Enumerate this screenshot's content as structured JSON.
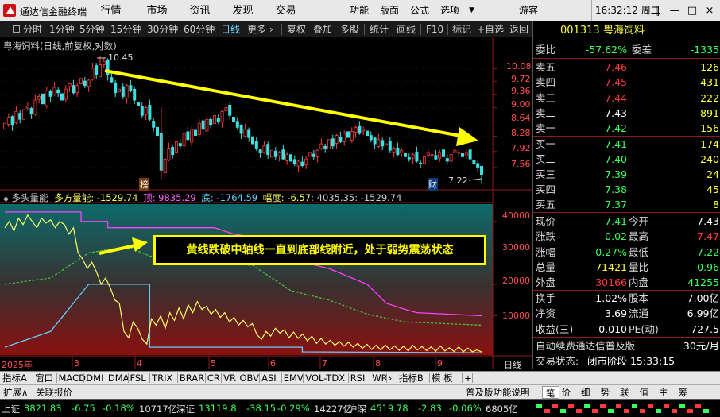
{
  "app": {
    "title": "通达信金融终端",
    "menus": [
      "行情",
      "市场",
      "资讯",
      "发现",
      "交易"
    ],
    "right_menus": [
      "功能",
      "版面",
      "公式",
      "选项"
    ],
    "user": "游客",
    "clock": "16:32:12 周二",
    "win_buttons": [
      "ǁ",
      "—",
      "□",
      "×"
    ]
  },
  "toolbar": {
    "periods": [
      "分时",
      "1分钟",
      "5分钟",
      "15分钟",
      "30分钟",
      "60分钟",
      "日线",
      "更多"
    ],
    "more_arrow": "›",
    "tools": [
      "复权",
      "叠加",
      "多股",
      "统计",
      "画线",
      "F10",
      "标记",
      "+自选",
      "返回"
    ]
  },
  "chart": {
    "main_title": "粤海饲料(日线,前复权,对数)",
    "price_ticks": [
      "10.08",
      "9.72",
      "9.36",
      "9.00",
      "8.64",
      "8.28",
      "7.92",
      "7.56"
    ],
    "high_label": "10.45",
    "low_label": "7.22",
    "badge_left": "榜",
    "badge_right": "财",
    "indicator": {
      "name": "多头量能",
      "label_main": "多方量能",
      "value_main": "-1529.74",
      "label_top": "顶",
      "value_top": "9835.29",
      "label_bottom": "底",
      "value_bottom": "-1764.59",
      "label_amp": "幅度",
      "value_amp": "-6.57",
      "value_amp2": "4035.35",
      "value_last": "-1529.74"
    },
    "ind_ticks": [
      "40000",
      "30000",
      "20000",
      "10000"
    ],
    "annotation": "黄线跌破中轴线一直到底部线附近，处于弱势震荡状态",
    "time_labels": [
      "2025年",
      "3",
      "4",
      "5",
      "6",
      "7",
      "8",
      "9"
    ],
    "period_label": "日线"
  },
  "chart_data": {
    "type": "candlestick",
    "title": "粤海饲料(日线,前复权,对数)",
    "y_scale": "log",
    "ylim": [
      7.2,
      10.5
    ],
    "y_ticks": [
      7.56,
      7.92,
      8.28,
      8.64,
      9.0,
      9.36,
      9.72,
      10.08
    ],
    "x_months": [
      "2025年",
      "3",
      "4",
      "5",
      "6",
      "7",
      "8",
      "9"
    ],
    "high": 10.45,
    "low": 7.22,
    "closes": [
      8.6,
      8.75,
      8.55,
      8.9,
      8.7,
      8.95,
      9.05,
      8.85,
      9.2,
      9.3,
      9.1,
      9.45,
      9.3,
      9.55,
      9.4,
      9.2,
      9.5,
      9.65,
      9.4,
      9.6,
      9.8,
      9.6,
      9.75,
      10.1,
      9.9,
      10.2,
      10.3,
      9.9,
      9.7,
      9.4,
      9.5,
      9.3,
      9.6,
      9.45,
      9.2,
      9.05,
      8.8,
      9.0,
      8.7,
      8.5,
      8.3,
      7.5,
      7.75,
      8.0,
      7.85,
      8.15,
      8.05,
      8.35,
      8.2,
      8.45,
      8.3,
      8.6,
      8.45,
      8.7,
      8.55,
      8.8,
      8.65,
      8.9,
      9.0,
      8.8,
      8.65,
      8.5,
      8.35,
      8.45,
      8.25,
      8.1,
      8.0,
      7.9,
      8.05,
      7.85,
      7.95,
      7.8,
      7.9,
      7.75,
      7.85,
      7.7,
      7.65,
      7.7,
      7.6,
      7.75,
      7.9,
      7.8,
      7.95,
      8.1,
      8.0,
      8.2,
      8.05,
      8.3,
      8.15,
      8.35,
      8.25,
      8.4,
      8.5,
      8.35,
      8.45,
      8.3,
      8.2,
      8.1,
      8.2,
      8.05,
      8.1,
      7.95,
      8.0,
      7.85,
      7.95,
      7.8,
      7.75,
      7.85,
      7.7,
      7.65,
      7.8,
      7.9,
      7.85,
      7.75,
      7.9,
      7.8,
      7.7,
      7.85,
      7.95,
      7.9,
      7.8,
      7.9,
      7.75,
      7.65,
      7.55,
      7.41
    ],
    "indicator": {
      "name": "多头量能",
      "ylim": [
        -2000,
        45000
      ],
      "y_ticks": [
        10000,
        20000,
        30000,
        40000
      ],
      "series": [
        {
          "label": "多方量能",
          "color": "#ffff66",
          "last": -1529.74
        },
        {
          "label": "顶",
          "color": "#ff40ff",
          "last": 9835.29
        },
        {
          "label": "底",
          "color": "#60d0ff",
          "last": -1764.59
        },
        {
          "label": "中轴",
          "color": "#40d040"
        }
      ]
    }
  },
  "quote": {
    "code": "001313",
    "name": "粤海饲料",
    "weibi_label": "委比",
    "weibi": "-57.62%",
    "weicha_label": "委差",
    "weicha": "-1335",
    "asks": [
      {
        "label": "卖五",
        "price": "7.46",
        "vol": "126"
      },
      {
        "label": "卖四",
        "price": "7.45",
        "vol": "431"
      },
      {
        "label": "卖三",
        "price": "7.44",
        "vol": "222"
      },
      {
        "label": "卖二",
        "price": "7.43",
        "vol": "891"
      },
      {
        "label": "卖一",
        "price": "7.42",
        "vol": "156"
      }
    ],
    "bids": [
      {
        "label": "买一",
        "price": "7.41",
        "vol": "174"
      },
      {
        "label": "买二",
        "price": "7.40",
        "vol": "240"
      },
      {
        "label": "买三",
        "price": "7.39",
        "vol": "24"
      },
      {
        "label": "买四",
        "price": "7.38",
        "vol": "45"
      },
      {
        "label": "买五",
        "price": "7.37",
        "vol": "8"
      }
    ],
    "stats": [
      {
        "l1": "现价",
        "v1": "7.41",
        "c1": "grn",
        "l2": "今开",
        "v2": "7.43",
        "c2": "wht"
      },
      {
        "l1": "涨跌",
        "v1": "-0.02",
        "c1": "grn",
        "l2": "最高",
        "v2": "7.47",
        "c2": "red"
      },
      {
        "l1": "涨幅",
        "v1": "-0.27%",
        "c1": "grn",
        "l2": "最低",
        "v2": "7.22",
        "c2": "grn"
      },
      {
        "l1": "总量",
        "v1": "71421",
        "c1": "yel",
        "l2": "量比",
        "v2": "0.96",
        "c2": "grn"
      },
      {
        "l1": "外盘",
        "v1": "30166",
        "c1": "red",
        "l2": "内盘",
        "v2": "41255",
        "c2": "grn"
      }
    ],
    "stats2": [
      {
        "l1": "换手",
        "v1": "1.02%",
        "l2": "股本",
        "v2": "7.00亿"
      },
      {
        "l1": "净资",
        "v1": "3.69",
        "l2": "流通",
        "v2": "6.99亿"
      },
      {
        "l1": "收益(三)",
        "v1": "0.010",
        "l2": "PE(动)",
        "v2": "727.5"
      }
    ],
    "promo": "自动续费通达信普及版",
    "promo_price": "30元/月",
    "trade_status_label": "交易状态:",
    "trade_status": "闭市阶段 15:33:15"
  },
  "bottom_tabs": [
    "指标A",
    "窗口",
    "MACD",
    "DMI",
    "DMA",
    "FSL",
    "TRIX",
    "BRAR",
    "CR",
    "VR",
    "OBV",
    "ASI",
    "EMV",
    "VOL-TDX",
    "RSI",
    "WR",
    "›",
    "指标B",
    "模 板",
    "+"
  ],
  "bar2": {
    "expand": "扩展∧",
    "linked": "关联报价",
    "edition": "普及版功能说明",
    "right_tabs": [
      "笔",
      "价",
      "细",
      "势",
      "联",
      "值",
      "主",
      "筹"
    ]
  },
  "status": {
    "items": [
      {
        "name": "上证",
        "val": "3821.83",
        "chg": "-6.75",
        "pct": "-0.18%",
        "amt": "10717亿"
      },
      {
        "name": "深证",
        "val": "13119.8",
        "chg": "-38.15",
        "pct": "-0.29%",
        "amt": "14227亿"
      },
      {
        "name": "沪深",
        "val": "4519.78",
        "chg": "-2.83",
        "pct": "-0.06%",
        "amt": "6805亿"
      }
    ]
  },
  "colors": {
    "up": "#ff3b3b",
    "down": "#3cff5a",
    "bg": "#000000",
    "accent": "#ffff00"
  }
}
